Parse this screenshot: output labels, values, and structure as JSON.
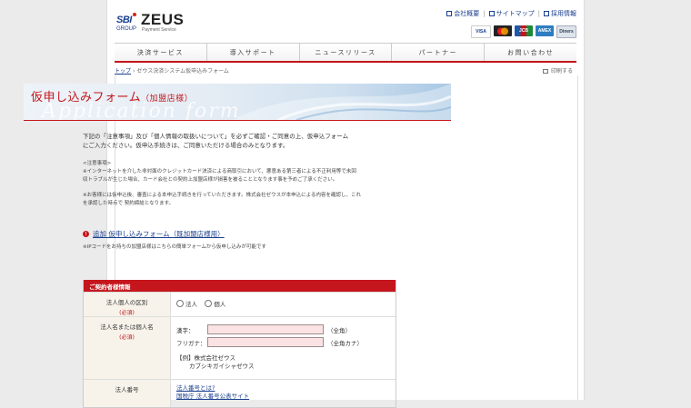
{
  "header": {
    "logo_sbi": "SBI",
    "logo_group": "GROUP",
    "logo_zeus": "ZEUS",
    "logo_tagline": "Payment Service",
    "links": [
      "会社概要",
      "サイトマップ",
      "採用情報"
    ],
    "cards": [
      {
        "name": "VISA",
        "color": "#1a3f8f"
      },
      {
        "name": "MC",
        "color": "#e8a21a"
      },
      {
        "name": "JCB",
        "color": "#1d5aa8"
      },
      {
        "name": "AMEX",
        "color": "#2e7dc0"
      },
      {
        "name": "Diners",
        "color": "#9aa8b8"
      }
    ]
  },
  "nav": {
    "items": [
      "決済サービス",
      "導入サポート",
      "ニュースリリース",
      "パートナー",
      "お問い合わせ"
    ]
  },
  "breadcrumb": {
    "home": "トップ",
    "separator": "›",
    "current": "ゼウス決済システム仮申込みフォーム"
  },
  "print_label": "印刷する",
  "banner": {
    "title": "仮申し込みフォーム",
    "subtitle": "（加盟店様）",
    "bg_text": "Application form"
  },
  "intro": {
    "line1": "下記の「注意事項」及び「個人情報の取扱いについて」を必ずご確認・ご同意の上、仮申込フォーム",
    "line2": "にご入力ください。仮申込手続きは、ご同意いただける場合のみとなります。"
  },
  "caution": {
    "heading": "<注意事項>",
    "line1": "※インターネットを介した非対面のクレジットカード決済による商取引において、悪意ある第三者による不正利用等で未回",
    "line2": "収トラブルが生じた場合、カード会社との契約上加盟店様が損害を被ることとなります事を予めご了承ください。",
    "line3": "※お客様には仮申込後、審査による本申込手続きを行っていただきます。株式会社ゼウスが本申込による内容を確認し、これ",
    "line4": "を承認した時点で 契約締結となります。"
  },
  "app_link": {
    "icon": "!",
    "text": "追加 仮申し込みフォーム（既加盟店様用）"
  },
  "ip_note": "※IPコードをお持ちの加盟店様はこちらの簡単フォームから仮申し込みが可能です",
  "form": {
    "section_title": "ご契約者様情報",
    "required": "(必須)",
    "row1": {
      "label": "法人個人の区別",
      "options": [
        "法人",
        "個人"
      ]
    },
    "row2": {
      "label": "法人名または個人名",
      "kanji_label": "漢字：",
      "kanji_hint": "（全角）",
      "kana_label": "フリガナ：",
      "kana_hint": "（全角カナ）",
      "example1": "【例】株式会社ゼウス",
      "example2": "カブシキガイシャゼウス"
    },
    "row3": {
      "label": "法人番号",
      "link1": "法人番号とは?",
      "link2": "国税庁 法人番号公表サイト"
    }
  }
}
